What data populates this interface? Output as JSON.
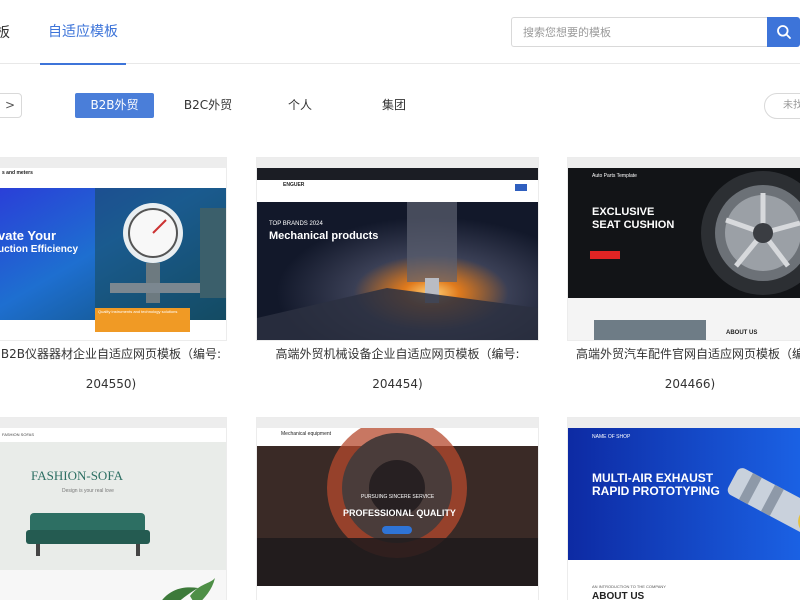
{
  "header": {
    "nav_partial": "板",
    "active_tab": "自适应模板",
    "search_placeholder": "搜索您想要的模板"
  },
  "filters": {
    "back_label": ">",
    "items": [
      "B2B外贸",
      "B2C外贸",
      "个人",
      "集团"
    ],
    "active_index": 0,
    "right_partial": "未找"
  },
  "cards": [
    {
      "title_line1": "B2B仪器器材企业自适应网页模板（编号:",
      "title_line2": "204550)",
      "preview": {
        "brand": "s and meters",
        "headline1": "vate Your",
        "headline2": "uction Efficiency",
        "box_text": "Quality instruments and technology solutions"
      }
    },
    {
      "title_line1": "高端外贸机械设备企业自适应网页模板（编号:",
      "title_line2": "204454)",
      "preview": {
        "brand": "ENGUER",
        "kicker": "TOP BRANDS 2024",
        "headline": "Mechanical products"
      }
    },
    {
      "title_line1": "高端外贸汽车配件官网自适应网页模板（编",
      "title_line2": "204466)",
      "preview": {
        "brand": "Auto Parts Template",
        "headline1": "EXCLUSIVE",
        "headline2": "SEAT CUSHION",
        "sub": "ABOUT US"
      }
    },
    {
      "preview": {
        "brand": "FASHION SOFAS",
        "headline": "FASHION-SOFA",
        "sub": "Design is your real love"
      }
    },
    {
      "preview": {
        "brand": "Mechanical equipment",
        "kicker": "PURSUING SINCERE SERVICE",
        "headline": "PROFESSIONAL QUALITY"
      }
    },
    {
      "preview": {
        "brand": "NAME OF SHOP",
        "headline1": "MULTI-AIR EXHAUST",
        "headline2": "RAPID PROTOTYPING",
        "sub1": "AN INTRODUCTION TO THE COMPANY",
        "sub2": "ABOUT US"
      }
    }
  ],
  "colors": {
    "accent": "#3d74d9",
    "active_filter": "#4a7ed9"
  }
}
